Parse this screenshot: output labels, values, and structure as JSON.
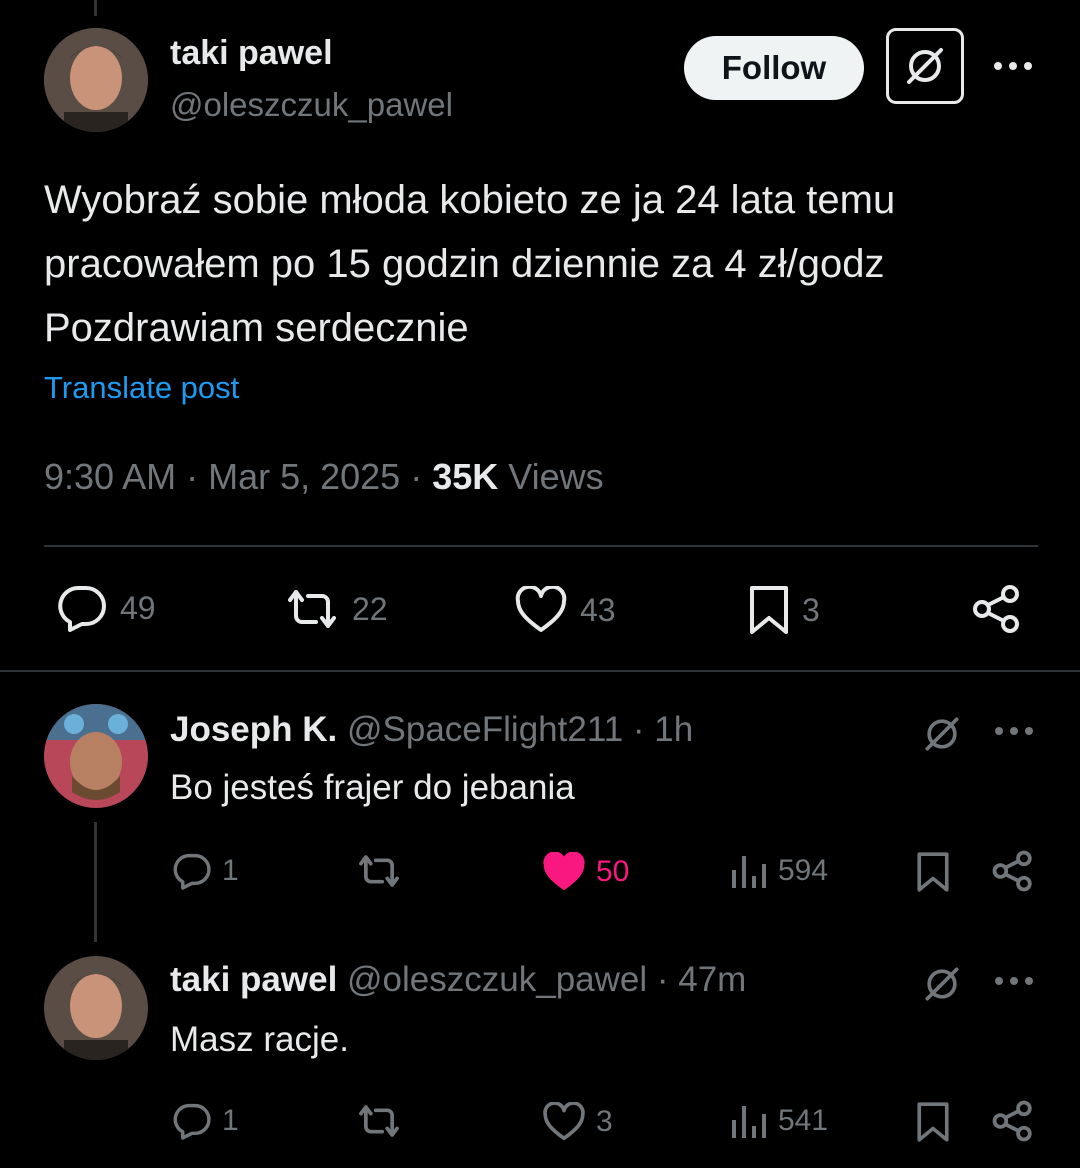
{
  "main_post": {
    "author_name": "taki pawel",
    "author_handle": "@oleszczuk_pawel",
    "follow_label": "Follow",
    "grok_icon": "grok-icon",
    "more_icon": "more-icon",
    "text_line1": "Wyobraź sobie młoda kobieto ze ja 24 lata temu",
    "text_line2": "pracowałem po 15 godzin dziennie za 4 zł/godz",
    "text_line3": "Pozdrawiam serdecznie",
    "translate_label": "Translate post",
    "time": "9:30 AM · Mar 5, 2025 ·",
    "views_count": "35K",
    "views_label": "Views",
    "replies": "49",
    "reposts": "22",
    "likes": "43",
    "bookmarks": "3"
  },
  "replies": [
    {
      "author_name": "Joseph K.",
      "meta": "@SpaceFlight211 · 1h",
      "text": "Bo jesteś frajer do jebania",
      "replies": "1",
      "likes": "50",
      "liked": true,
      "views": "594"
    },
    {
      "author_name": "taki pawel",
      "meta": "@oleszczuk_pawel · 47m",
      "text": "Masz racje.",
      "replies": "1",
      "likes": "3",
      "liked": false,
      "views": "541"
    }
  ],
  "colors": {
    "background": "#000000",
    "text": "#e7e9ea",
    "muted": "#71767b",
    "link": "#1d9bf0",
    "like_active": "#f91880"
  }
}
